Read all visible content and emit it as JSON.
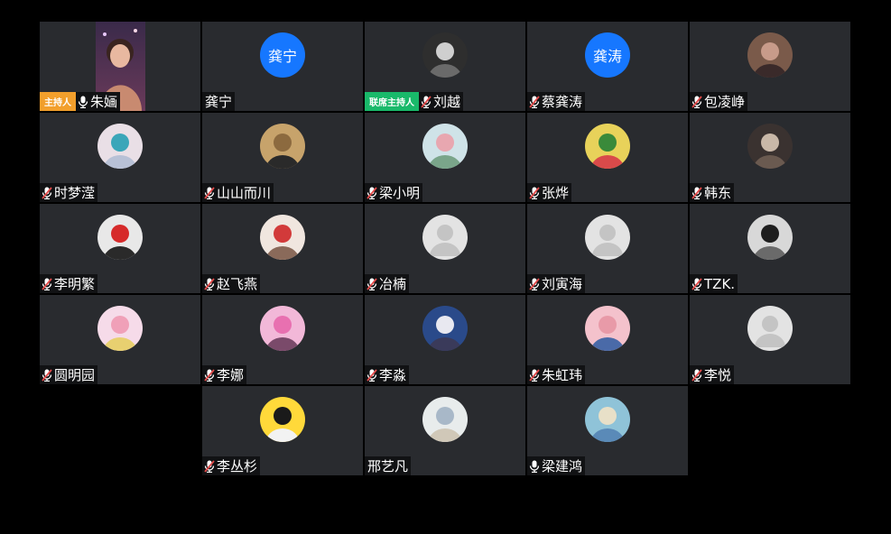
{
  "colors": {
    "background": "#000000",
    "tile": "#292b2f",
    "label_bg": "#111214",
    "host_badge": "#f29f2c",
    "cohost_badge": "#19b96a",
    "text_avatar": "#1677ff",
    "mic_muted": "#e34b4b"
  },
  "participants": [
    {
      "name": "朱婳",
      "role": "主持人",
      "role_type": "host",
      "mic": "on",
      "media": "video",
      "avatar_text": ""
    },
    {
      "name": "龚宁",
      "role": "",
      "role_type": "",
      "mic": "none",
      "media": "text",
      "avatar_text": "龚宁"
    },
    {
      "name": "刘越",
      "role": "联席主持人",
      "role_type": "cohost",
      "mic": "muted",
      "media": "photo",
      "avatar_text": ""
    },
    {
      "name": "蔡龚涛",
      "role": "",
      "role_type": "",
      "mic": "muted",
      "media": "text",
      "avatar_text": "龚涛"
    },
    {
      "name": "包凌峥",
      "role": "",
      "role_type": "",
      "mic": "muted",
      "media": "photo",
      "avatar_text": ""
    },
    {
      "name": "时梦滢",
      "role": "",
      "role_type": "",
      "mic": "muted",
      "media": "photo",
      "avatar_text": ""
    },
    {
      "name": "山山而川",
      "role": "",
      "role_type": "",
      "mic": "muted",
      "media": "photo",
      "avatar_text": ""
    },
    {
      "name": "梁小明",
      "role": "",
      "role_type": "",
      "mic": "muted",
      "media": "photo",
      "avatar_text": ""
    },
    {
      "name": "张烨",
      "role": "",
      "role_type": "",
      "mic": "muted",
      "media": "photo",
      "avatar_text": ""
    },
    {
      "name": "韩东",
      "role": "",
      "role_type": "",
      "mic": "muted",
      "media": "photo",
      "avatar_text": ""
    },
    {
      "name": "李明繁",
      "role": "",
      "role_type": "",
      "mic": "muted",
      "media": "photo",
      "avatar_text": ""
    },
    {
      "name": "赵飞燕",
      "role": "",
      "role_type": "",
      "mic": "muted",
      "media": "photo",
      "avatar_text": ""
    },
    {
      "name": "冶楠",
      "role": "",
      "role_type": "",
      "mic": "muted",
      "media": "placeholder",
      "avatar_text": ""
    },
    {
      "name": "刘寅海",
      "role": "",
      "role_type": "",
      "mic": "muted",
      "media": "placeholder",
      "avatar_text": ""
    },
    {
      "name": "TZK.",
      "role": "",
      "role_type": "",
      "mic": "muted",
      "media": "photo",
      "avatar_text": ""
    },
    {
      "name": "圆明园",
      "role": "",
      "role_type": "",
      "mic": "muted",
      "media": "photo",
      "avatar_text": ""
    },
    {
      "name": "李娜",
      "role": "",
      "role_type": "",
      "mic": "muted",
      "media": "photo",
      "avatar_text": ""
    },
    {
      "name": "李淼",
      "role": "",
      "role_type": "",
      "mic": "muted",
      "media": "photo",
      "avatar_text": ""
    },
    {
      "name": "朱虹玮",
      "role": "",
      "role_type": "",
      "mic": "muted",
      "media": "photo",
      "avatar_text": ""
    },
    {
      "name": "李悦",
      "role": "",
      "role_type": "",
      "mic": "muted",
      "media": "placeholder",
      "avatar_text": ""
    },
    {
      "name": "李丛杉",
      "role": "",
      "role_type": "",
      "mic": "muted",
      "media": "photo",
      "avatar_text": ""
    },
    {
      "name": "邢艺凡",
      "role": "",
      "role_type": "",
      "mic": "none",
      "media": "photo",
      "avatar_text": ""
    },
    {
      "name": "梁建鸿",
      "role": "",
      "role_type": "",
      "mic": "on",
      "media": "photo",
      "avatar_text": ""
    }
  ]
}
